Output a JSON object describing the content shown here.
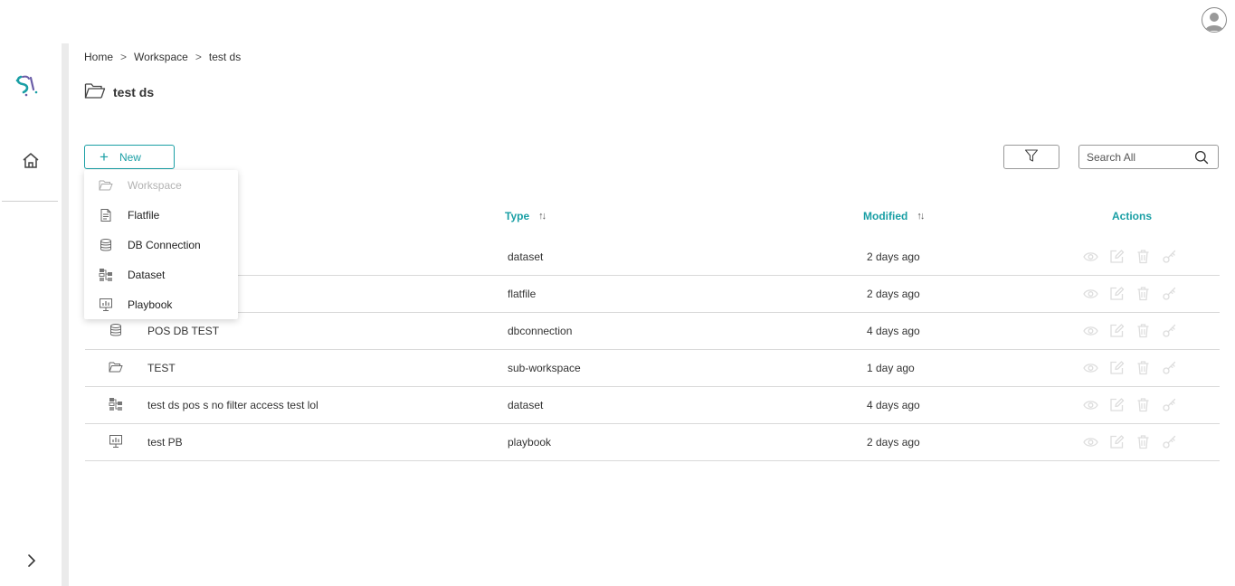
{
  "breadcrumb": {
    "items": [
      "Home",
      "Workspace",
      "test ds"
    ],
    "separator": ">"
  },
  "page": {
    "title": "test ds"
  },
  "toolbar": {
    "new_label": "New",
    "search_placeholder": "Search All"
  },
  "new_menu": {
    "items": [
      {
        "label": "Workspace",
        "icon": "folder-open-icon",
        "disabled": true
      },
      {
        "label": "Flatfile",
        "icon": "document-icon",
        "disabled": false
      },
      {
        "label": "DB Connection",
        "icon": "database-icon",
        "disabled": false
      },
      {
        "label": "Dataset",
        "icon": "dataset-icon",
        "disabled": false
      },
      {
        "label": "Playbook",
        "icon": "presentation-chart-icon",
        "disabled": false
      }
    ]
  },
  "table": {
    "columns": {
      "type": "Type",
      "modified": "Modified",
      "actions": "Actions"
    },
    "rows": [
      {
        "icon": "dataset-icon",
        "name": "",
        "type": "dataset",
        "modified": "2 days ago"
      },
      {
        "icon": "document-icon",
        "name": "",
        "type": "flatfile",
        "modified": "2 days ago"
      },
      {
        "icon": "database-icon",
        "name": "POS DB TEST",
        "type": "dbconnection",
        "modified": "4 days ago"
      },
      {
        "icon": "folder-open-icon",
        "name": "TEST",
        "type": "sub-workspace",
        "modified": "1 day ago"
      },
      {
        "icon": "dataset-icon",
        "name": "test ds pos s no filter access test lol",
        "type": "dataset",
        "modified": "4 days ago"
      },
      {
        "icon": "presentation-chart-icon",
        "name": "test PB",
        "type": "playbook",
        "modified": "2 days ago"
      }
    ],
    "row_actions": [
      "view-icon",
      "edit-icon",
      "delete-icon",
      "key-icon"
    ]
  },
  "colors": {
    "accent": "#1a9fa5",
    "action_icon": "#dedede",
    "divider": "#ebebeb"
  }
}
